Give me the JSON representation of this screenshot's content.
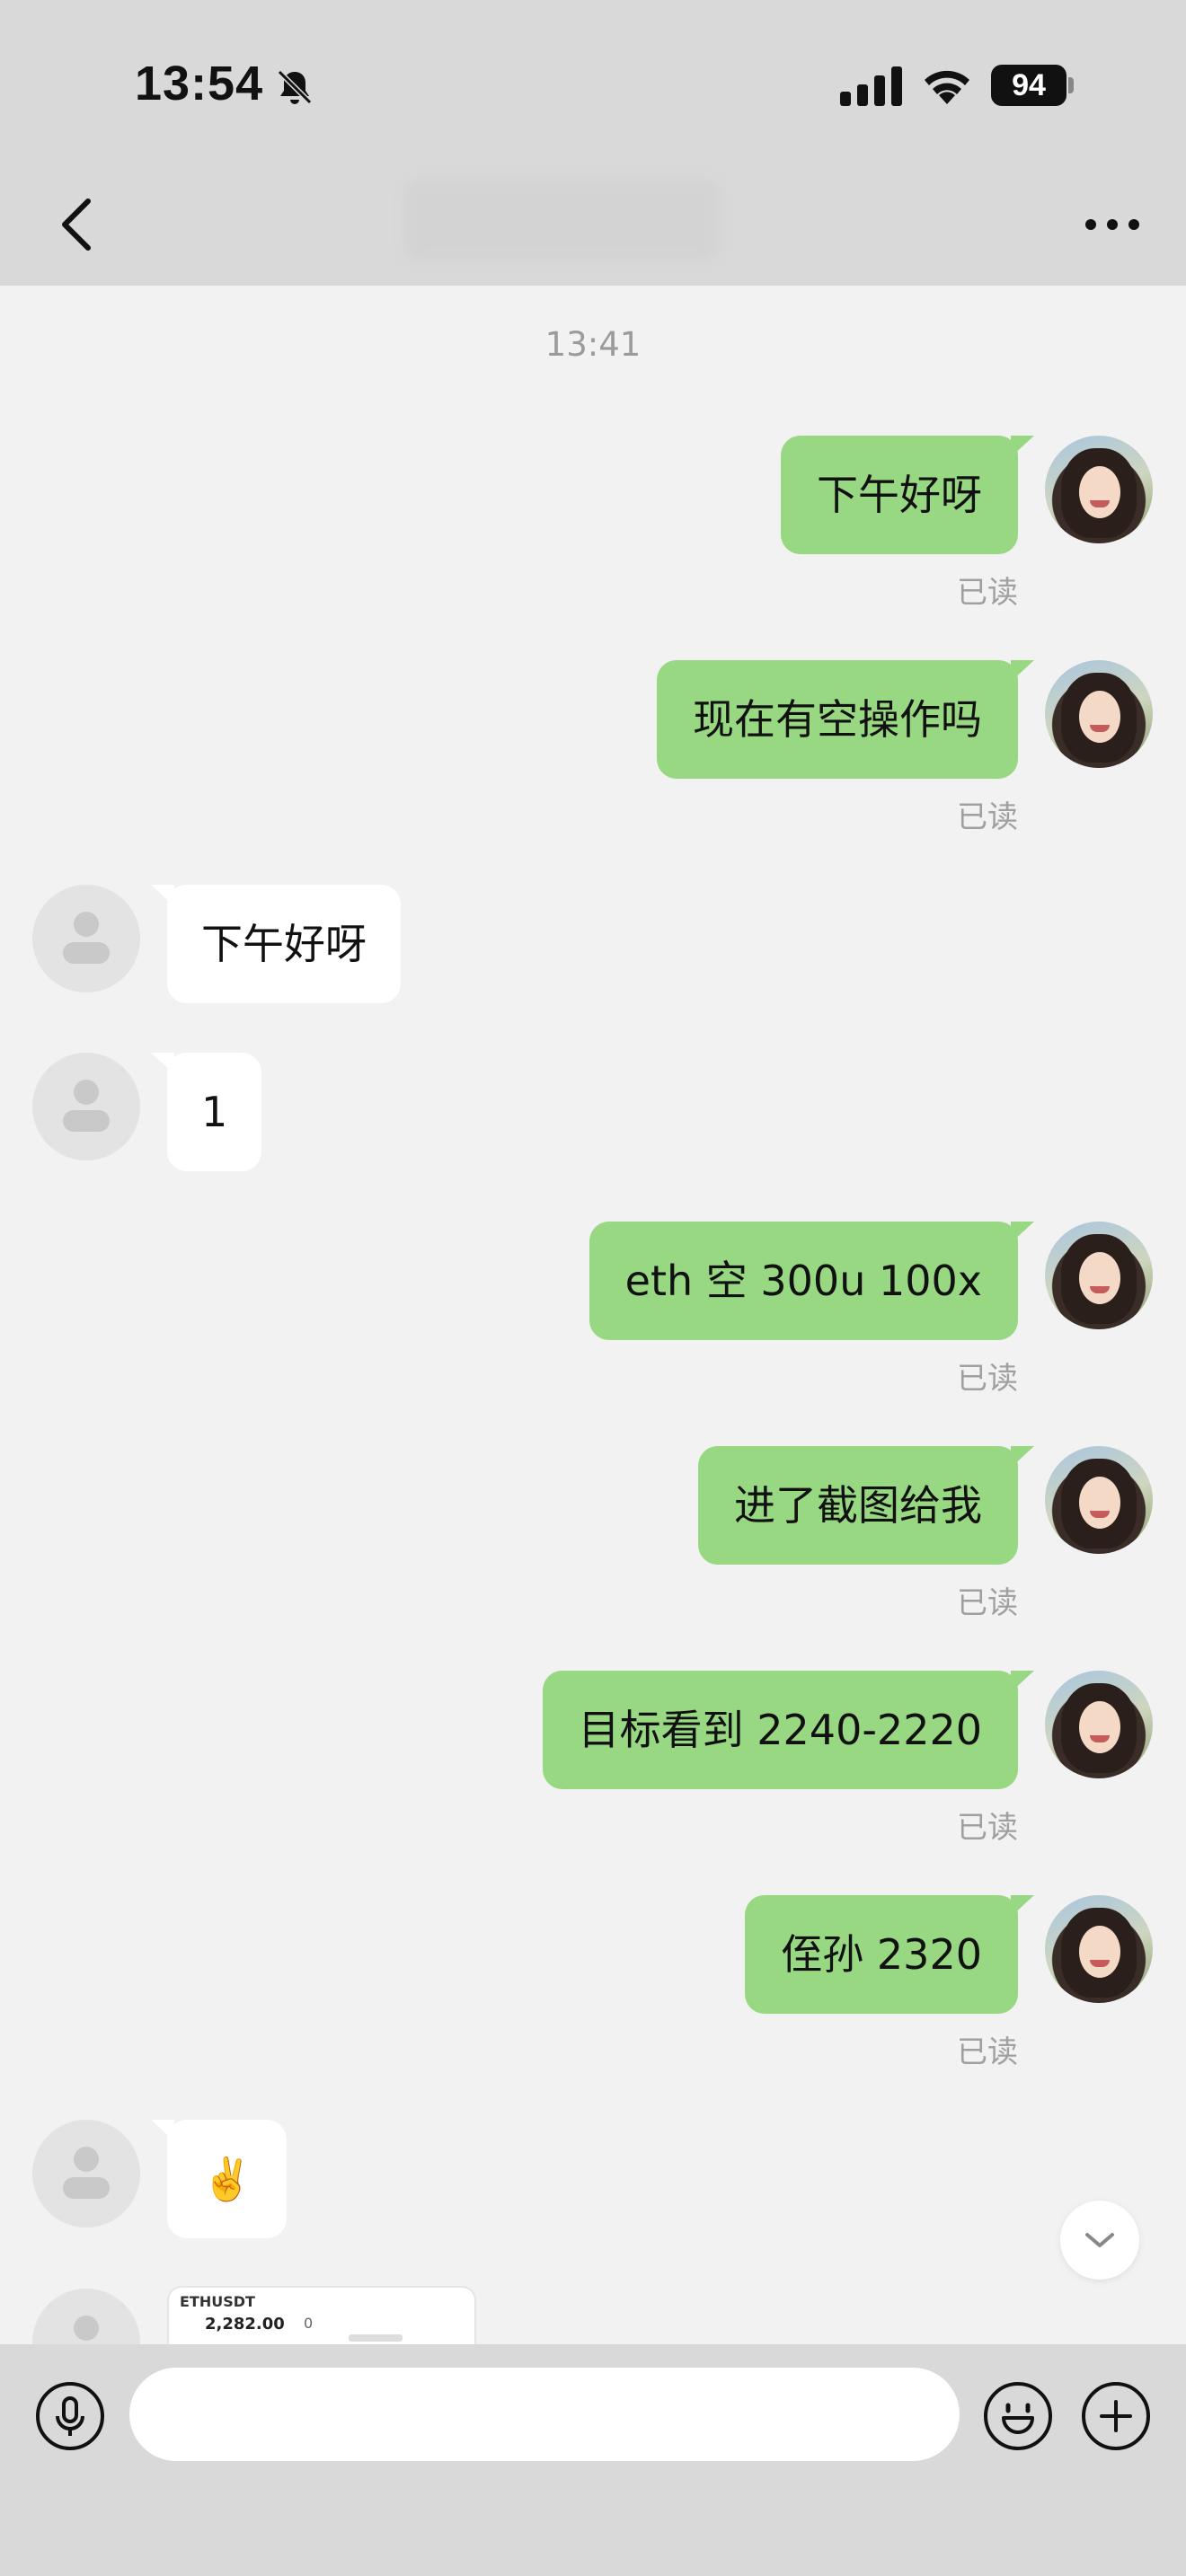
{
  "status_bar": {
    "time": "13:54",
    "battery": "94"
  },
  "header": {
    "title": ""
  },
  "chat": {
    "timestamp": "13:41",
    "messages": [
      {
        "side": "out",
        "text": "下午好呀",
        "read": "已读"
      },
      {
        "side": "out",
        "text": "现在有空操作吗",
        "read": "已读"
      },
      {
        "side": "in",
        "text": "下午好呀"
      },
      {
        "side": "in",
        "text": "1"
      },
      {
        "side": "out",
        "text": "eth 空 300u 100x",
        "read": "已读"
      },
      {
        "side": "out",
        "text": "进了截图给我",
        "read": "已读"
      },
      {
        "side": "out",
        "text": "目标看到 2240-2220",
        "read": "已读"
      },
      {
        "side": "out",
        "text": "侄孙 2320",
        "read": "已读"
      },
      {
        "side": "in",
        "text": "✌️"
      }
    ],
    "image_preview": {
      "line1": "ETHUSDT",
      "line2": "2,282.00",
      "line3": "0"
    }
  },
  "input": {
    "placeholder": ""
  },
  "colors": {
    "outgoing_bubble": "#98d883",
    "incoming_bubble": "#ffffff",
    "background": "#f2f2f2",
    "bar": "#d9d9d9"
  }
}
